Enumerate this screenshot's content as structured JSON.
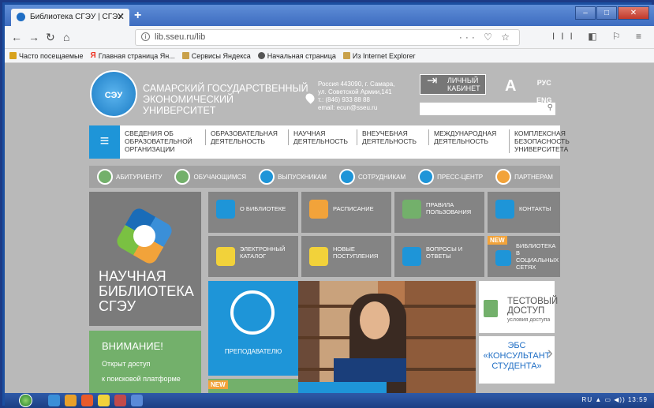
{
  "browser": {
    "tab_title": "Библиотека СГЭУ | СГЭУ",
    "tab_close": "✕",
    "new_tab": "+",
    "url": "lib.sseu.ru/lib",
    "url_actions": "··· ♡ ☆",
    "right_icons": "III ◧ ⚐ ≡",
    "bookmarks": [
      "Часто посещаемые",
      "Главная страница Ян...",
      "Сервисы Яндекса",
      "Начальная страница",
      "Из Internet Explorer"
    ]
  },
  "header": {
    "logo_text": "СЭУ",
    "university_name": "САМАРСКИЙ ГОСУДАРСТВЕННЫЙ ЭКОНОМИЧЕСКИЙ УНИВЕРСИТЕТ",
    "address_line1": "Россия 443090, г. Самара,",
    "address_line2": "ул. Советской Армии,141",
    "phone": "т.: (846) 933 88 88",
    "email": "email: ecun@sseu.ru",
    "cabinet_label": "ЛИЧНЫЙ КАБИНЕТ",
    "font_toggle": "A",
    "lang_ru": "РУС",
    "lang_en": "ENG"
  },
  "main_menu": [
    "СВЕДЕНИЯ ОБ ОБРАЗОВАТЕЛЬНОЙ ОРГАНИЗАЦИИ",
    "ОБРАЗОВАТЕЛЬНАЯ ДЕЯТЕЛЬНОСТЬ",
    "НАУЧНАЯ ДЕЯТЕЛЬНОСТЬ",
    "ВНЕУЧЕБНАЯ ДЕЯТЕЛЬНОСТЬ",
    "МЕЖДУНАРОДНАЯ ДЕЯТЕЛЬНОСТЬ",
    "КОМПЛЕКСНАЯ БЕЗОПАСНОСТЬ УНИВЕРСИТЕТА"
  ],
  "audience": [
    "АБИТУРИЕНТУ",
    "ОБУЧАЮЩИМСЯ",
    "ВЫПУСКНИКАМ",
    "СОТРУДНИКАМ",
    "ПРЕСС-ЦЕНТР",
    "ПАРТНЕРАМ"
  ],
  "hero": {
    "title": "НАУЧНАЯ\nБИБЛИОТЕКА\nСГЭУ"
  },
  "attention": {
    "title": "ВНИМАНИЕ!",
    "line1": "Открыт доступ",
    "line2": "к поисковой платформе"
  },
  "tiles": {
    "about": "О БИБЛИОТЕКЕ",
    "schedule": "РАСПИСАНИЕ",
    "rules": "ПРАВИЛА ПОЛЬЗОВАНИЯ",
    "contacts": "КОНТАКТЫ",
    "catalog": "ЭЛЕКТРОННЫЙ КАТАЛОГ",
    "new_arrivals": "НОВЫЕ ПОСТУПЛЕНИЯ",
    "faq": "ВОПРОСЫ И ОТВЕТЫ",
    "social": "БИБЛИОТЕКА В СОЦИАЛЬНЫХ СЕТЯХ",
    "new_badge": "NEW"
  },
  "teachers": "ПРЕПОДАВАТЕЛЮ",
  "test_access": {
    "title": "ТЕСТОВЫЙ ДОСТУП",
    "subtitle": "условия доступа"
  },
  "ebs": {
    "line1": "ЭБС",
    "line2": "«КОНСУЛЬТАНТ",
    "line3": "СТУДЕНТА»"
  },
  "taskbar": {
    "lang": "RU",
    "time": "13:59"
  },
  "colors": {
    "accent_blue": "#1e95d8",
    "accent_green": "#73b06b",
    "accent_orange": "#f2a33a",
    "tile_gray": "#848484"
  }
}
